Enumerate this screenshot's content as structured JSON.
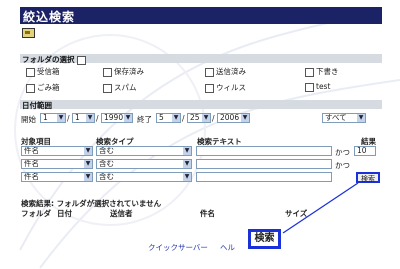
{
  "title": "絞込検索",
  "folder_section": {
    "label": "フォルダの選択",
    "folders": [
      [
        "受信箱",
        "保存済み",
        "送信済み",
        "下書き"
      ],
      [
        "ごみ箱",
        "スパム",
        "ウィルス",
        "test"
      ]
    ]
  },
  "date_section": {
    "label": "日付範囲",
    "start_label": "開始",
    "end_label": "終了",
    "start": {
      "month": "1",
      "day": "1",
      "year": "1990"
    },
    "end": {
      "month": "5",
      "day": "25",
      "year": "2006"
    },
    "range_select": "すべて"
  },
  "criteria": {
    "headers": {
      "item": "対象項目",
      "type": "検索タイプ",
      "text": "検索テキスト",
      "result": "結果"
    },
    "rows": [
      {
        "item": "件名",
        "type": "含む",
        "conj": "かつ"
      },
      {
        "item": "件名",
        "type": "含む",
        "conj": "かつ"
      },
      {
        "item": "件名",
        "type": "含む",
        "conj": ""
      }
    ],
    "result_count": "10",
    "search_button": "検索"
  },
  "results": {
    "message": "検索結果: フォルダが選択されていません",
    "columns": [
      "フォルダ",
      "日付",
      "送信者",
      "件名",
      "サイズ"
    ]
  },
  "footer": {
    "links": [
      "クイックサーバー",
      "ヘル"
    ]
  },
  "zoom_button": "検索",
  "colors": {
    "title_bg": "#1b2366",
    "section_bg": "#d6dbe2",
    "highlight": "#1a30d8"
  },
  "icons": {
    "toolbar": "folder-up-icon"
  }
}
